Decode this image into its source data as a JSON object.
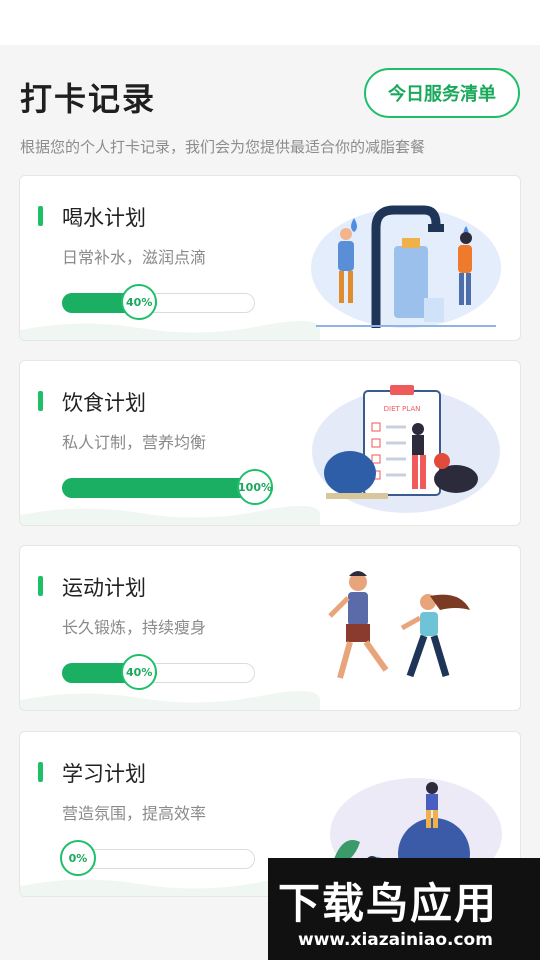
{
  "header": {
    "title": "打卡记录",
    "service_button": "今日服务清单",
    "subtitle": "根据您的个人打卡记录，我们会为您提供最适合你的减脂套餐"
  },
  "plans": [
    {
      "title": "喝水计划",
      "desc": "日常补水，滋润点滴",
      "progress_label": "40%",
      "progress": 0.4
    },
    {
      "title": "饮食计划",
      "desc": "私人订制，营养均衡",
      "progress_label": "100%",
      "progress": 1.0
    },
    {
      "title": "运动计划",
      "desc": "长久锻炼，持续瘦身",
      "progress_label": "40%",
      "progress": 0.4
    },
    {
      "title": "学习计划",
      "desc": "营造氛围，提高效率",
      "progress_label": "0%",
      "progress": 0.0
    }
  ],
  "illustrations": {
    "diet_board_label": "DIET PLAN"
  },
  "watermark": {
    "brand": "下载鸟应用",
    "url": "www.xiazainiao.com"
  },
  "colors": {
    "accent": "#1fbf6a",
    "fill": "#1aaf62"
  }
}
